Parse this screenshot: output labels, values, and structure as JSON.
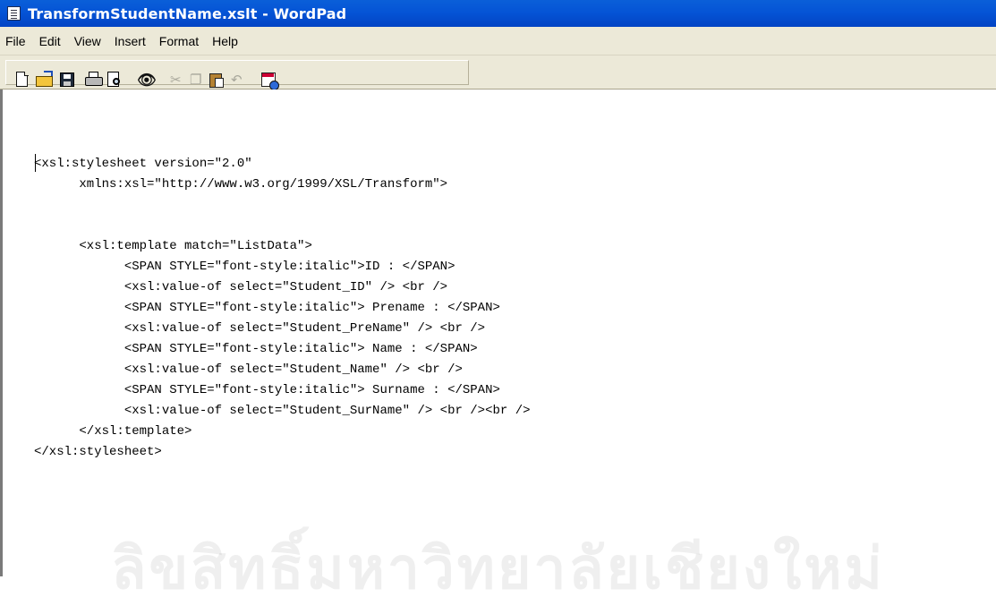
{
  "window": {
    "title": "TransformStudentName.xslt - WordPad",
    "app_icon": "wordpad-document-icon"
  },
  "menu": {
    "items": [
      "File",
      "Edit",
      "View",
      "Insert",
      "Format",
      "Help"
    ]
  },
  "toolbar": {
    "buttons": [
      {
        "icon": "new-document-icon",
        "enabled": true
      },
      {
        "icon": "open-folder-icon",
        "enabled": true
      },
      {
        "icon": "save-disk-icon",
        "enabled": true
      },
      {
        "icon": "print-icon",
        "enabled": true
      },
      {
        "icon": "print-preview-icon",
        "enabled": true
      },
      {
        "icon": "find-binoculars-icon",
        "enabled": true
      },
      {
        "icon": "cut-icon",
        "enabled": false
      },
      {
        "icon": "copy-icon",
        "enabled": false
      },
      {
        "icon": "paste-icon",
        "enabled": true
      },
      {
        "icon": "undo-icon",
        "enabled": false
      },
      {
        "icon": "insert-date-time-icon",
        "enabled": true
      }
    ]
  },
  "document": {
    "lines": [
      "<xsl:stylesheet version=\"2.0\"",
      "      xmlns:xsl=\"http://www.w3.org/1999/XSL/Transform\">",
      "",
      "",
      "      <xsl:template match=\"ListData\">",
      "            <SPAN STYLE=\"font-style:italic\">ID : </SPAN>",
      "            <xsl:value-of select=\"Student_ID\" /> <br />",
      "            <SPAN STYLE=\"font-style:italic\"> Prename : </SPAN>",
      "            <xsl:value-of select=\"Student_PreName\" /> <br />",
      "            <SPAN STYLE=\"font-style:italic\"> Name : </SPAN>",
      "            <xsl:value-of select=\"Student_Name\" /> <br />",
      "            <SPAN STYLE=\"font-style:italic\"> Surname : </SPAN>",
      "            <xsl:value-of select=\"Student_SurName\" /> <br /><br />",
      "      </xsl:template>",
      "</xsl:stylesheet>"
    ]
  },
  "watermark": {
    "text": "ลิขสิทธิ์มหาวิทยาลัยเชียงใหม่",
    "colors": {
      "watermark": "#7a7a7a"
    }
  },
  "colors": {
    "titlebar": "#0554d6",
    "chrome": "#ece9d8",
    "document_bg": "#ffffff"
  }
}
